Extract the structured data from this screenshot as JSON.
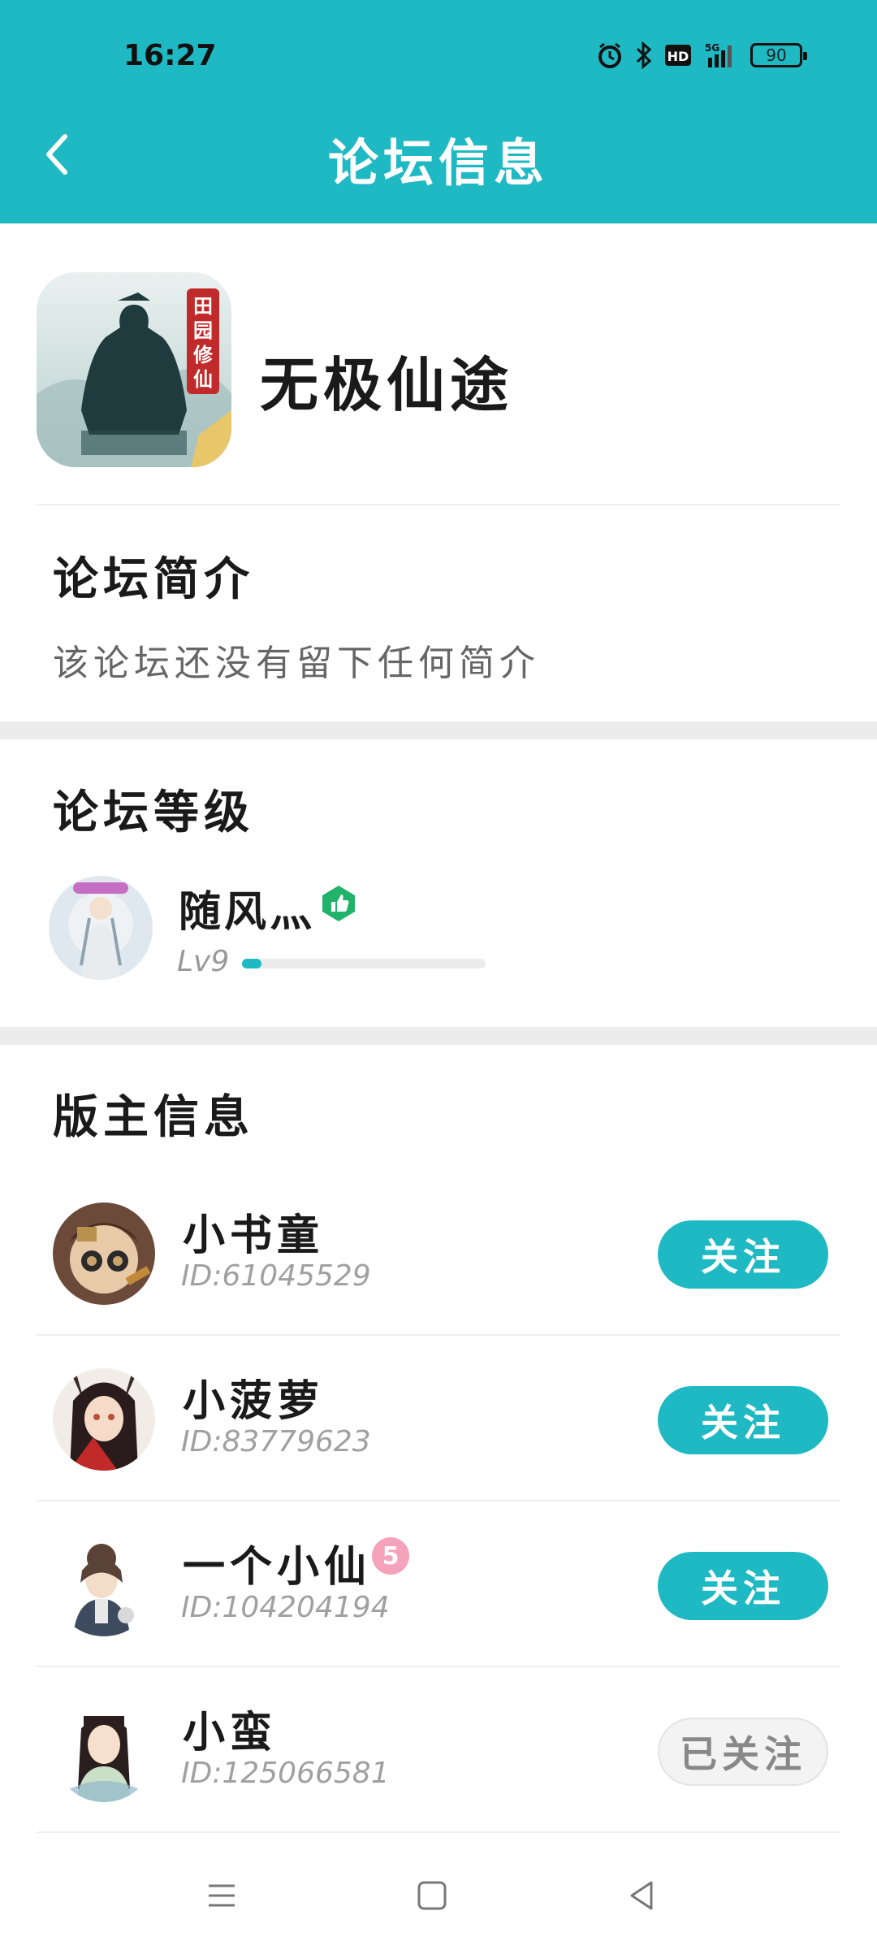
{
  "status_bar": {
    "time": "16:27",
    "network": "5G",
    "battery": "90"
  },
  "header": {
    "title": "论坛信息"
  },
  "forum": {
    "name": "无极仙途",
    "logo_text": "田园修仙"
  },
  "intro": {
    "title": "论坛简介",
    "text": "该论坛还没有留下任何简介"
  },
  "level": {
    "title": "论坛等级",
    "user_name": "随风灬",
    "level_label": "Lv9",
    "progress": 0.08
  },
  "moderators": {
    "title": "版主信息",
    "items": [
      {
        "name": "小书童",
        "id": "ID:61045529",
        "button": "关注",
        "followed": false
      },
      {
        "name": "小菠萝",
        "id": "ID:83779623",
        "button": "关注",
        "followed": false
      },
      {
        "name": "一个小仙",
        "id": "ID:104204194",
        "button": "关注",
        "followed": false,
        "badge": "5"
      },
      {
        "name": "小蛮",
        "id": "ID:125066581",
        "button": "已关注",
        "followed": true
      }
    ]
  },
  "colors": {
    "accent": "#1fb9c3",
    "divider": "#ececec"
  },
  "icons": {
    "back": "back-arrow-icon",
    "level_badge": "thumbs-up-badge-icon",
    "nav": [
      "menu-icon",
      "home-square-icon",
      "back-triangle-icon"
    ]
  }
}
